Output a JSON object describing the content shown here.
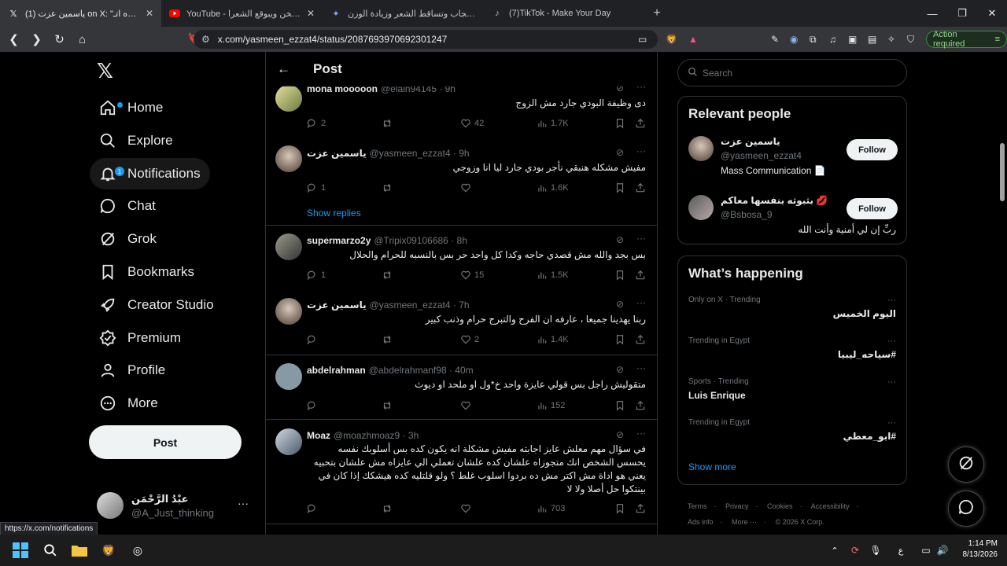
{
  "browser": {
    "tabs": [
      {
        "title": "(1) ياسمين عزت on X: \"انا عايزه اتـ",
        "favicon": "x-logo",
        "active": true
      },
      {
        "title": "YouTube - الحجاب بيتخن ويبوقع الشعرا",
        "favicon": "youtube-logo",
        "active": false
      },
      {
        "title": "الحجاب وتساقط الشعر وزيادة الوزن - ...",
        "favicon": "gemini-logo",
        "active": false
      },
      {
        "title": "(7)TikTok - Make Your Day",
        "favicon": "tiktok-logo",
        "active": false
      }
    ],
    "url": "x.com/yasmeen_ezzat4/status/2087693970692301247",
    "action_required": "Action required",
    "status_url": "https://x.com/notifications"
  },
  "nav": {
    "items": [
      {
        "label": "Home",
        "icon": "home-icon"
      },
      {
        "label": "Explore",
        "icon": "search-icon"
      },
      {
        "label": "Notifications",
        "icon": "bell-icon",
        "badge": "1"
      },
      {
        "label": "Chat",
        "icon": "chat-icon"
      },
      {
        "label": "Grok",
        "icon": "grok-icon"
      },
      {
        "label": "Bookmarks",
        "icon": "bookmark-icon"
      },
      {
        "label": "Creator Studio",
        "icon": "rocket-icon"
      },
      {
        "label": "Premium",
        "icon": "verified-icon"
      },
      {
        "label": "Profile",
        "icon": "person-icon"
      },
      {
        "label": "More",
        "icon": "more-circle-icon"
      }
    ],
    "post_button": "Post",
    "account": {
      "name": "عبْدُ الرَّحْمَن",
      "handle": "@A_Just_thinking"
    }
  },
  "center": {
    "title": "Post",
    "tweets": [
      {
        "name": "mona mooooon",
        "handle": "@elain94145",
        "time": "9h",
        "text": "دى وظيفة البودي جارد مش الزوج",
        "replies": "2",
        "likes": "42",
        "views": "1.7K"
      },
      {
        "name": "ياسمين عزت",
        "handle": "@yasmeen_ezzat4",
        "time": "9h",
        "text": "مفيش مشكله هنبقي نأجر بودي جارد ليا انا وزوجي",
        "replies": "1",
        "likes": "",
        "views": "1.6K"
      },
      {
        "name": "supermarzo2y",
        "handle": "@Tripix09106686",
        "time": "8h",
        "text": "بس بجد والله مش قصدي حاجه وكدا كل واحد حر بس بالنسبه للحرام والحلال",
        "replies": "1",
        "likes": "15",
        "views": "1.5K"
      },
      {
        "name": "ياسمين عزت",
        "handle": "@yasmeen_ezzat4",
        "time": "7h",
        "text": "ربنا يهدينا جميعا ، عارفه ان الفرح  والتبرج حرام وذنب كبير",
        "replies": "",
        "likes": "2",
        "views": "1.4K"
      },
      {
        "name": "abdelrahman",
        "handle": "@abdelrahmanf98",
        "time": "40m",
        "text": "متقوليش راجل بس قولي عايزة واحد خ*ول او ملحد او ديوث",
        "replies": "",
        "likes": "",
        "views": "152"
      },
      {
        "name": "Moaz",
        "handle": "@moazhmoaz9",
        "time": "3h",
        "text": "في سؤال مهم معلش عايز اجابته مفيش مشكلة انه يكون كده بس أسلوبك نفسه يحسس الشخص انك متجوزاه علشان كده علشان تعملي الي عايزاه مش علشان بتحبيه يعني هو اداة مش اكتر مش ده بردوا اسلوب غلط ؟ ولو قلتليه كده هيشكك إذا كان في بينتكوا حل أصلا ولا لا",
        "replies": "",
        "likes": "",
        "views": "703"
      }
    ],
    "show_replies": "Show replies"
  },
  "right": {
    "search_placeholder": "Search",
    "relevant_title": "Relevant people",
    "people": [
      {
        "name": "ياسمين عزت",
        "handle": "@yasmeen_ezzat4",
        "bio": "Mass Communication 📄",
        "follow": "Follow"
      },
      {
        "name": "بثبوثه بنفسها معاكم 💋",
        "handle": "@Bsbosa_9",
        "bio": "ربِّ إن لي أمنية وأنت الله",
        "follow": "Follow"
      }
    ],
    "happening_title": "What’s happening",
    "trends": [
      {
        "meta": "Only on X · Trending",
        "name": "اليوم الخميس"
      },
      {
        "meta": "Trending in Egypt",
        "name": "#سياحه_ليبيا"
      },
      {
        "meta": "Sports · Trending",
        "name": "Luis Enrique"
      },
      {
        "meta": "Trending in Egypt",
        "name": "#ابو_معطي"
      }
    ],
    "show_more": "Show more",
    "footer": [
      "Terms",
      "Privacy",
      "Cookies",
      "Accessibility",
      "Ads info",
      "More ···",
      "© 2026 X Corp."
    ]
  },
  "taskbar": {
    "time": "1:14 PM",
    "date": "8/13/2026",
    "lang": "ع"
  }
}
